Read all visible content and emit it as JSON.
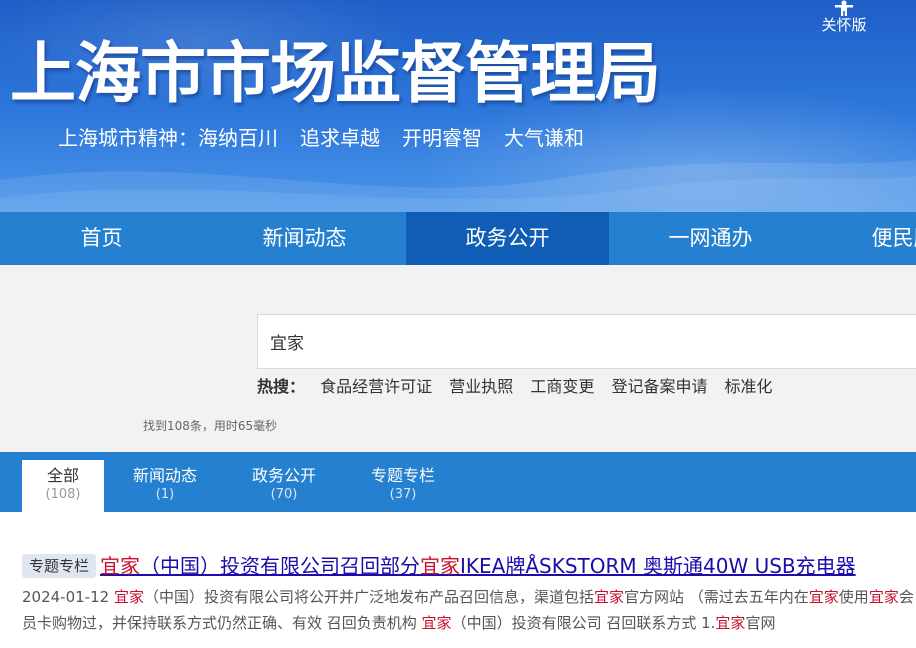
{
  "header": {
    "title": "上海市市场监督管理局",
    "slogan": [
      "上海城市精神：海纳百川",
      "追求卓越",
      "开明睿智",
      "大气谦和"
    ],
    "care_mode_label": "关怀版",
    "care_mode_icon": "accessibility-person-icon"
  },
  "nav": {
    "items": [
      "首页",
      "新闻动态",
      "政务公开",
      "一网通办",
      "便民服务"
    ],
    "active_index": 2
  },
  "search": {
    "query": "宜家",
    "hot_label": "热搜：",
    "hot_terms": [
      "食品经营许可证",
      "营业执照",
      "工商变更",
      "登记备案申请",
      "标准化"
    ],
    "stats": "找到108条，用时65毫秒"
  },
  "tabs": [
    {
      "name": "全部",
      "count": "(108)"
    },
    {
      "name": "新闻动态",
      "count": "(1)"
    },
    {
      "name": "政务公开",
      "count": "(70)"
    },
    {
      "name": "专题专栏",
      "count": "(37)"
    }
  ],
  "results": [
    {
      "badge": "专题专栏",
      "title_parts": [
        "宜家",
        "（中国）投资有限公司召回部分",
        "宜家",
        "IKEA牌ÅSKSTORM 奥斯通40W USB充电器"
      ],
      "snippet_parts": [
        "2024-01-12 ",
        "宜家",
        "（中国）投资有限公司将公开并广泛地发布产品召回信息，渠道包括",
        "宜家",
        "官方网站 （需过去五年内在",
        "宜家",
        "使用",
        "宜家",
        "会员卡购物过，并保持联系方式仍然正确、有效 召回负责机构 ",
        "宜家",
        "（中国）投资有限公司 召回联系方式 1.",
        "宜家",
        "官网"
      ]
    }
  ],
  "colors": {
    "nav_bg": "#2580cf",
    "nav_active": "#0f5db4",
    "highlight": "#c8102e",
    "link": "#1a0dab"
  }
}
